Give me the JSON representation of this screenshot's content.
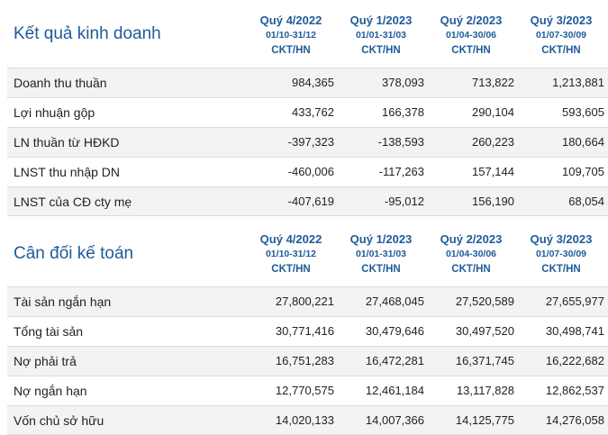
{
  "columns": [
    {
      "quarter": "Quý 4/2022",
      "period": "01/10-31/12",
      "unit": "CKT/HN"
    },
    {
      "quarter": "Quý 1/2023",
      "period": "01/01-31/03",
      "unit": "CKT/HN"
    },
    {
      "quarter": "Quý 2/2023",
      "period": "01/04-30/06",
      "unit": "CKT/HN"
    },
    {
      "quarter": "Quý 3/2023",
      "period": "01/07-30/09",
      "unit": "CKT/HN"
    }
  ],
  "business_results": {
    "title": "Kết quả kinh doanh",
    "rows": [
      {
        "label": "Doanh thu thuần",
        "values": [
          "984,365",
          "378,093",
          "713,822",
          "1,213,881"
        ]
      },
      {
        "label": "Lợi nhuận gộp",
        "values": [
          "433,762",
          "166,378",
          "290,104",
          "593,605"
        ]
      },
      {
        "label": "LN thuần từ HĐKD",
        "values": [
          "-397,323",
          "-138,593",
          "260,223",
          "180,664"
        ]
      },
      {
        "label": "LNST thu nhập DN",
        "values": [
          "-460,006",
          "-117,263",
          "157,144",
          "109,705"
        ]
      },
      {
        "label": "LNST của CĐ cty mẹ",
        "values": [
          "-407,619",
          "-95,012",
          "156,190",
          "68,054"
        ]
      }
    ]
  },
  "balance_sheet": {
    "title": "Cân đối kế toán",
    "rows": [
      {
        "label": "Tài sản ngắn hạn",
        "values": [
          "27,800,221",
          "27,468,045",
          "27,520,589",
          "27,655,977"
        ]
      },
      {
        "label": "Tổng tài sản",
        "values": [
          "30,771,416",
          "30,479,646",
          "30,497,520",
          "30,498,741"
        ]
      },
      {
        "label": "Nợ phải trả",
        "values": [
          "16,751,283",
          "16,472,281",
          "16,371,745",
          "16,222,682"
        ]
      },
      {
        "label": "Nợ ngắn hạn",
        "values": [
          "12,770,575",
          "12,461,184",
          "13,117,828",
          "12,862,537"
        ]
      },
      {
        "label": "Vốn chủ sở hữu",
        "values": [
          "14,020,133",
          "14,007,366",
          "14,125,775",
          "14,276,058"
        ]
      }
    ]
  }
}
